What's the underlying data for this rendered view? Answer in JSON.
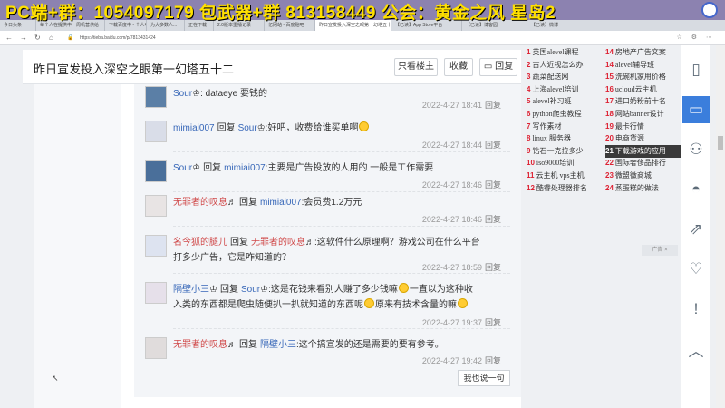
{
  "overlay": {
    "text": "PC端+群：1054097179 包武器+群 813158449 公会：黄金之风 星岛2"
  },
  "browser": {
    "tabs": [
      "今日头条",
      "每个人在提供中",
      "周机营供给",
      "下载百度中 - 个人中心",
      "为大多数人...",
      "正在下载",
      "2.0版本重播记录",
      "亿网站 - 百度贴吧",
      "昨日宣发投入深空之眼第一幻塔五十二",
      "【已读】App Store平台",
      "【已读】博客园",
      "【已读】微博"
    ],
    "active_tab": 8,
    "url": "https://tieba.baidu.com/p/7813431424"
  },
  "thread": {
    "title": "昨日宣发投入深空之眼第一幻塔五十二",
    "only_owner": "只看楼主",
    "collect": "收藏",
    "reply": "回复"
  },
  "comments": [
    {
      "user": "Sour",
      "badge": "♔",
      "user_style": "blue",
      "reply_label": "",
      "reply_to": "",
      "reply_badge": "",
      "text": ": dataeye 要钱的",
      "emoji": false,
      "time": "2022-4-27 18:41",
      "reply_link": "回复"
    },
    {
      "user": "mimiai007",
      "badge": "",
      "user_style": "blue",
      "reply_label": "回复",
      "reply_to": "Sour",
      "reply_badge": "♔",
      "text": ":好吧，收费给谁买单啊",
      "emoji": true,
      "time": "2022-4-27 18:44",
      "reply_link": "回复"
    },
    {
      "user": "Sour",
      "badge": "♔",
      "user_style": "blue",
      "reply_label": "回复",
      "reply_to": "mimiai007",
      "reply_badge": "",
      "text": ":主要是广告投放的人用的 一般是工作需要",
      "emoji": false,
      "time": "2022-4-27 18:46",
      "reply_link": "回复"
    },
    {
      "user": "无罪者的叹息",
      "badge": "♬",
      "user_style": "red",
      "reply_label": "回复",
      "reply_to": "mimiai007",
      "reply_badge": "",
      "text": ":会员费1.2万元",
      "emoji": false,
      "time": "2022-4-27 18:46",
      "reply_link": "回复"
    },
    {
      "user": "名今狐的腿儿",
      "badge": "",
      "user_style": "red",
      "reply_label": "回复",
      "reply_to": "无罪者的叹息",
      "reply_badge": "♬",
      "text": ":这软件什么原理啊？游戏公司在什么平台打多少广告，它是咋知道的？",
      "emoji": false,
      "time": "2022-4-27 18:59",
      "reply_link": "回复"
    },
    {
      "user": "隔壁小三",
      "badge": "♔",
      "user_style": "blue",
      "reply_label": "回复",
      "reply_to": "Sour",
      "reply_badge": "♔",
      "text": ":这是花钱来看别人赚了多少钱嘛",
      "text2": "一直以为这种收入类的东西都是爬虫随便扒一扒就知道的东西呢",
      "text3": "原来有技术含量的嘛",
      "emoji": true,
      "time": "2022-4-27 19:37",
      "reply_link": "回复"
    },
    {
      "user": "无罪者的叹息",
      "badge": "♬",
      "user_style": "red",
      "reply_label": "回复",
      "reply_to": "隔壁小三",
      "reply_badge": "",
      "text": ":这个搞宣发的还是需要的要有参考。",
      "emoji": false,
      "time": "2022-4-27 19:42",
      "reply_link": "回复"
    }
  ],
  "say_button": "我也说一句",
  "hot_list": [
    {
      "n": "1",
      "t": "英国alevel课程"
    },
    {
      "n": "14",
      "t": "房地产广告文案"
    },
    {
      "n": "2",
      "t": "古人近视怎么办"
    },
    {
      "n": "14",
      "t": "alevel辅导班"
    },
    {
      "n": "3",
      "t": "蔬菜配送网"
    },
    {
      "n": "15",
      "t": "洗碗机家用价格"
    },
    {
      "n": "4",
      "t": "上海alevel培训"
    },
    {
      "n": "16",
      "t": "ucloud云主机"
    },
    {
      "n": "5",
      "t": "alevel补习班"
    },
    {
      "n": "17",
      "t": "进口奶粉前十名"
    },
    {
      "n": "6",
      "t": "python爬虫教程"
    },
    {
      "n": "18",
      "t": "网站banner设计"
    },
    {
      "n": "7",
      "t": "写作素材"
    },
    {
      "n": "19",
      "t": "最卡行情"
    },
    {
      "n": "8",
      "t": "linux 服务器"
    },
    {
      "n": "20",
      "t": "电商货源"
    },
    {
      "n": "9",
      "t": "钻石一克拉多少"
    },
    {
      "n": "21",
      "t": "下载游戏的应用"
    },
    {
      "n": "10",
      "t": "iso9000培训"
    },
    {
      "n": "22",
      "t": "国际奢侈品排行"
    },
    {
      "n": "11",
      "t": "云主机 vps主机"
    },
    {
      "n": "23",
      "t": "微盟微商城"
    },
    {
      "n": "12",
      "t": "酷睿处理器排名"
    },
    {
      "n": "24",
      "t": "蒸蛋糕的做法"
    }
  ],
  "hot_highlight_index": 17,
  "tip_chip": "广告 ×",
  "side_tools": [
    "phone-icon",
    "message-icon",
    "robot-icon",
    "tieba-icon",
    "share-icon",
    "heart-icon",
    "report-icon",
    "up-arrow-icon"
  ],
  "colors": {
    "link": "#3767b8",
    "accent": "#3b7edc",
    "hot_num": "#dd2233"
  }
}
